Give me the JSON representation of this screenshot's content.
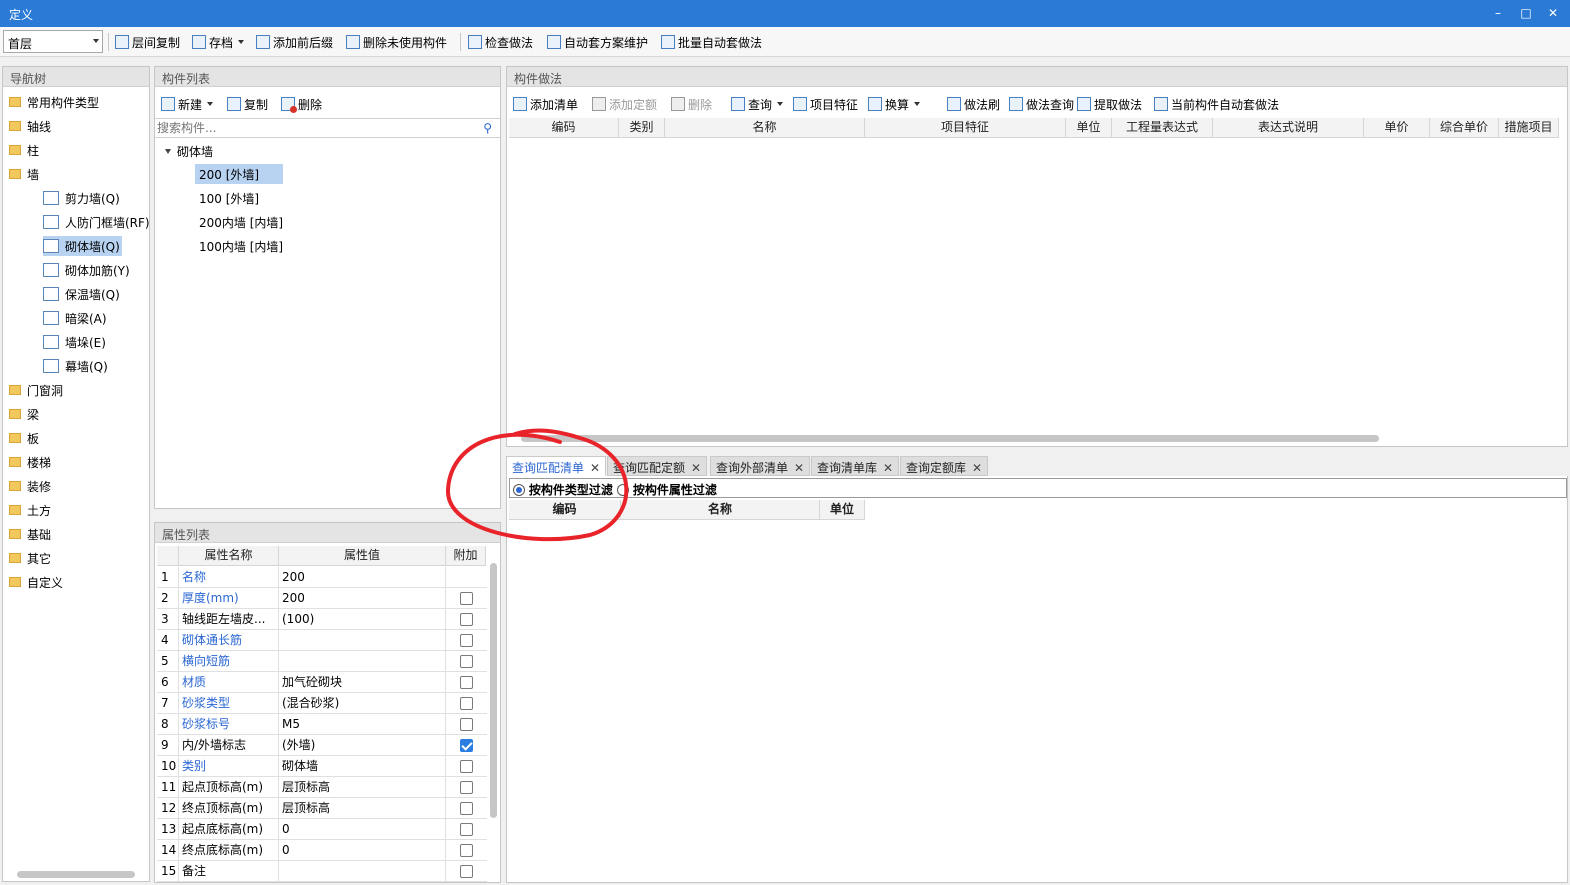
{
  "window": {
    "title": "定义",
    "controls": [
      "–",
      "□",
      "✕"
    ]
  },
  "toolbar": {
    "floor": "首层",
    "buttons": [
      "层间复制",
      "存档",
      "添加前后缀",
      "删除未使用构件",
      "检查做法",
      "自动套方案维护",
      "批量自动套做法"
    ]
  },
  "nav": {
    "title": "导航树",
    "top": [
      "常用构件类型",
      "轴线",
      "柱",
      "墙"
    ],
    "wall_children": [
      "剪力墙(Q)",
      "人防门框墙(RF)",
      "砌体墙(Q)",
      "砌体加筋(Y)",
      "保温墙(Q)",
      "暗梁(A)",
      "墙垛(E)",
      "幕墙(Q)"
    ],
    "bottom": [
      "门窗洞",
      "梁",
      "板",
      "楼梯",
      "装修",
      "土方",
      "基础",
      "其它",
      "自定义"
    ]
  },
  "components": {
    "title": "构件列表",
    "toolbar": [
      "新建",
      "复制",
      "删除"
    ],
    "search_placeholder": "搜索构件...",
    "group": "砌体墙",
    "items": [
      "200 [外墙]",
      "100 [外墙]",
      "200内墙 [内墙]",
      "100内墙 [内墙]"
    ]
  },
  "props": {
    "title": "属性列表",
    "headers": [
      "属性名称",
      "属性值",
      "附加"
    ],
    "rows": [
      {
        "n": "1",
        "name": "名称",
        "value": "200",
        "blue": true,
        "check": null
      },
      {
        "n": "2",
        "name": "厚度(mm)",
        "value": "200",
        "blue": true,
        "check": false
      },
      {
        "n": "3",
        "name": "轴线距左墙皮...",
        "value": "(100)",
        "blue": false,
        "check": false
      },
      {
        "n": "4",
        "name": "砌体通长筋",
        "value": "",
        "blue": true,
        "check": false
      },
      {
        "n": "5",
        "name": "横向短筋",
        "value": "",
        "blue": true,
        "check": false
      },
      {
        "n": "6",
        "name": "材质",
        "value": "加气砼砌块",
        "blue": true,
        "check": false
      },
      {
        "n": "7",
        "name": "砂浆类型",
        "value": "(混合砂浆)",
        "blue": true,
        "check": false
      },
      {
        "n": "8",
        "name": "砂浆标号",
        "value": "M5",
        "blue": true,
        "check": false
      },
      {
        "n": "9",
        "name": "内/外墙标志",
        "value": "(外墙)",
        "blue": false,
        "check": true
      },
      {
        "n": "10",
        "name": "类别",
        "value": "砌体墙",
        "blue": true,
        "check": false
      },
      {
        "n": "11",
        "name": "起点顶标高(m)",
        "value": "层顶标高",
        "blue": false,
        "check": false
      },
      {
        "n": "12",
        "name": "终点顶标高(m)",
        "value": "层顶标高",
        "blue": false,
        "check": false
      },
      {
        "n": "13",
        "name": "起点底标高(m)",
        "value": "0",
        "blue": false,
        "check": false
      },
      {
        "n": "14",
        "name": "终点底标高(m)",
        "value": "0",
        "blue": false,
        "check": false
      },
      {
        "n": "15",
        "name": "备注",
        "value": "",
        "blue": false,
        "check": false
      }
    ]
  },
  "methods": {
    "title": "构件做法",
    "toolbar": [
      "添加清单",
      "添加定额",
      "删除",
      "查询",
      "项目特征",
      "换算",
      "做法刷",
      "做法查询",
      "提取做法",
      "当前构件自动套做法"
    ],
    "columns": [
      "编码",
      "类别",
      "名称",
      "项目特征",
      "单位",
      "工程量表达式",
      "表达式说明",
      "单价",
      "综合单价",
      "措施项目"
    ]
  },
  "query": {
    "tabs": [
      "查询匹配清单",
      "查询匹配定额",
      "查询外部清单",
      "查询清单库",
      "查询定额库"
    ],
    "filters": [
      "按构件类型过滤",
      "按构件属性过滤"
    ],
    "columns": [
      "编码",
      "名称",
      "单位"
    ]
  },
  "colors": {
    "titlebar": "#2b7bd6",
    "selection": "#b8d3f2",
    "link": "#2a66d2",
    "annotation": "#e8232a"
  }
}
